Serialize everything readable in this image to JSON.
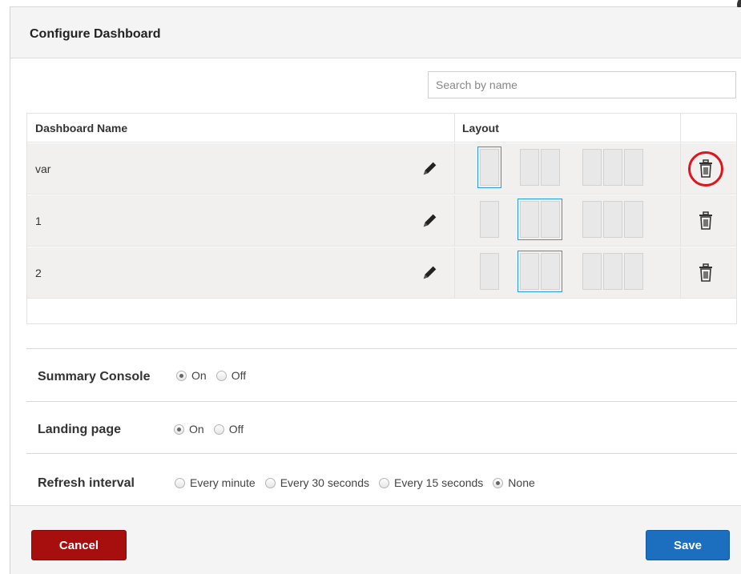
{
  "dialog": {
    "title": "Configure Dashboard"
  },
  "search": {
    "placeholder": "Search by name",
    "value": ""
  },
  "table": {
    "columns": {
      "name": "Dashboard Name",
      "layout": "Layout"
    },
    "rows": [
      {
        "name": "var",
        "selected_layout_columns": 1
      },
      {
        "name": "1",
        "selected_layout_columns": 2
      },
      {
        "name": "2",
        "selected_layout_columns": 2
      }
    ]
  },
  "settings": {
    "summary_console": {
      "label": "Summary Console",
      "options": [
        "On",
        "Off"
      ],
      "selected": "On"
    },
    "landing_page": {
      "label": "Landing page",
      "options": [
        "On",
        "Off"
      ],
      "selected": "On"
    },
    "refresh_interval": {
      "label": "Refresh interval",
      "options": [
        "Every minute",
        "Every 30 seconds",
        "Every 15 seconds",
        "None"
      ],
      "selected": "None"
    }
  },
  "buttons": {
    "cancel": "Cancel",
    "save": "Save"
  },
  "icons": {
    "edit": "pencil-icon",
    "delete": "trash-icon"
  },
  "colors": {
    "cancel": "#a70e0e",
    "save": "#1c6fbf",
    "layout_selected": "#2b9bd6",
    "highlight": "#e0141c"
  }
}
